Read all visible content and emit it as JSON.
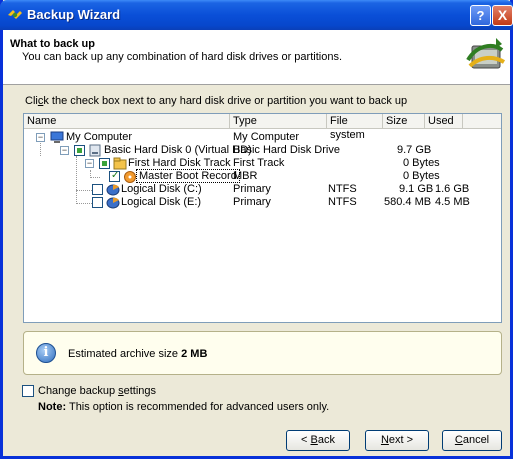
{
  "window": {
    "title": "Backup Wizard",
    "help_glyph": "?",
    "close_glyph": "X"
  },
  "header": {
    "title": "What to back up",
    "subtitle": "You can back up any combination of hard disk drives or partitions."
  },
  "instruction": {
    "pre": "Cli",
    "underlined": "c",
    "post": "k the check box next to any hard disk drive or partition you want to back up"
  },
  "tree": {
    "columns": [
      "Name",
      "Type",
      "File system",
      "Size",
      "Used"
    ],
    "rows": [
      {
        "name": "My Computer",
        "type": "My Computer",
        "fs": "",
        "size": "",
        "used": ""
      },
      {
        "name": "Basic Hard Disk 0 (Virtual HD)",
        "type": "Basic Hard Disk Drive",
        "fs": "",
        "size": "9.7 GB",
        "used": ""
      },
      {
        "name": "First Hard Disk Track",
        "type": "First Track",
        "fs": "",
        "size": "0 Bytes",
        "used": ""
      },
      {
        "name": "Master Boot Record",
        "type": "MBR",
        "fs": "",
        "size": "0 Bytes",
        "used": ""
      },
      {
        "name": "Logical Disk (C:)",
        "type": "Primary",
        "fs": "NTFS",
        "size": "9.1 GB",
        "used": "1.6 GB"
      },
      {
        "name": "Logical Disk (E:)",
        "type": "Primary",
        "fs": "NTFS",
        "size": "580.4 MB",
        "used": "4.5 MB"
      }
    ]
  },
  "info": {
    "text": "Estimated archive size",
    "value": "2 MB"
  },
  "options": {
    "change_label_pre": "Change backup ",
    "change_label_u": "s",
    "change_label_post": "ettings",
    "note_label": "Note:",
    "note_text": "This option is recommended for advanced users only."
  },
  "buttons": {
    "back_pre": "< ",
    "back_u": "B",
    "back_post": "ack",
    "next_u": "N",
    "next_post": "ext >",
    "cancel_u": "C",
    "cancel_post": "ancel"
  }
}
